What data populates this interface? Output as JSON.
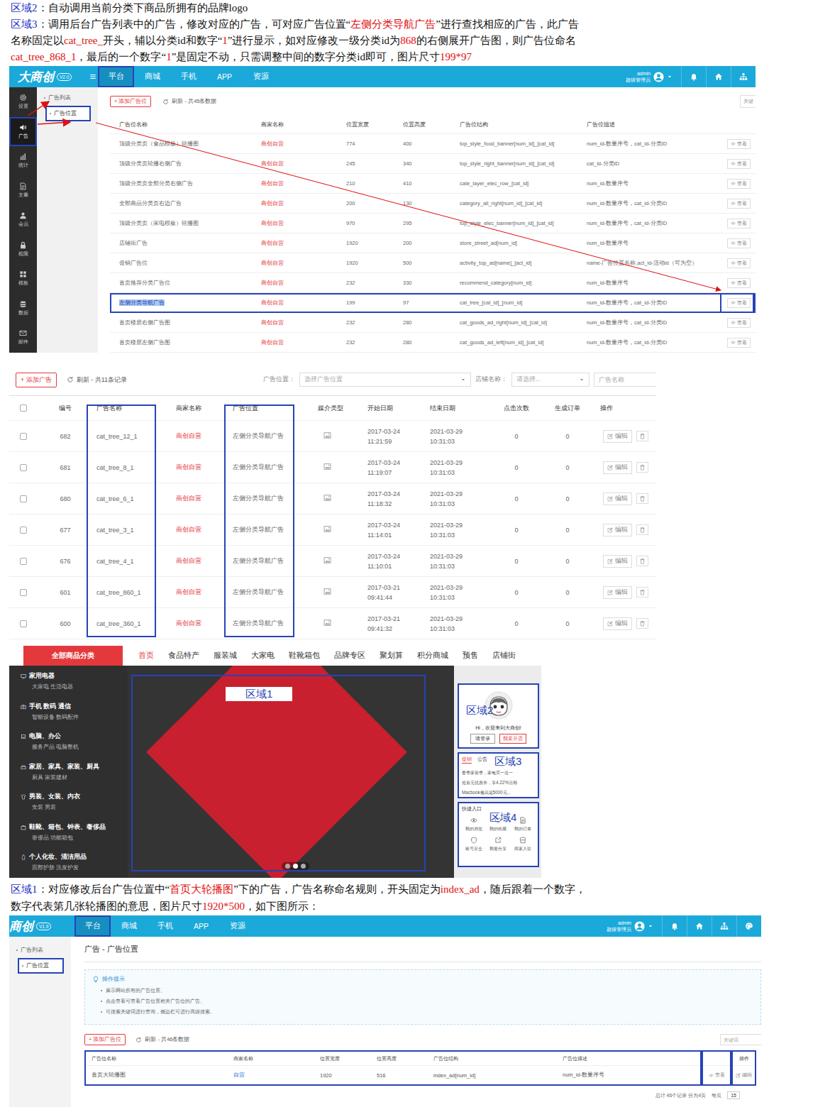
{
  "notes_top": [
    {
      "segments": [
        {
          "text": "区域2",
          "kind": "label"
        },
        {
          "text": "：自动调用当前分类下商品所拥有的品牌logo",
          "kind": "plain"
        }
      ]
    },
    {
      "segments": [
        {
          "text": "区域3",
          "kind": "label"
        },
        {
          "text": "：调用后台广告列表中的广告，修改对应的广告，可对应广告位置“",
          "kind": "plain"
        },
        {
          "text": "左侧分类导航广告",
          "kind": "highlight"
        },
        {
          "text": "”进行查找相应的广告，此广告名称固定以",
          "kind": "plain"
        },
        {
          "text": "cat_tree_",
          "kind": "highlight"
        },
        {
          "text": "开头，辅以分类id和数字“",
          "kind": "plain"
        },
        {
          "text": "1",
          "kind": "highlight"
        },
        {
          "text": "”进行显示，如对应修改一级分类id为",
          "kind": "plain"
        },
        {
          "text": "868",
          "kind": "highlight"
        },
        {
          "text": "的右侧展开广告图，则广告位命名",
          "kind": "plain"
        },
        {
          "text": "cat_tree_868_1",
          "kind": "highlight"
        },
        {
          "text": "，最后的一个数字“",
          "kind": "plain"
        },
        {
          "text": "1",
          "kind": "highlight"
        },
        {
          "text": "”是固定不动，只需调整中间的数字分类id即可，图片尺寸",
          "kind": "plain"
        },
        {
          "text": "199*97",
          "kind": "highlight"
        }
      ]
    }
  ],
  "admin1": {
    "logo": "大商创",
    "version": "V2.0",
    "nav": [
      {
        "label": "平台",
        "selected": true
      },
      {
        "label": "商城",
        "selected": false
      },
      {
        "label": "手机",
        "selected": false
      },
      {
        "label": "APP",
        "selected": false
      },
      {
        "label": "资源",
        "selected": false
      }
    ],
    "user": {
      "name": "admin",
      "role": "超级管理员"
    },
    "sidebar": [
      {
        "label": "设置",
        "selected": false
      },
      {
        "label": "广告",
        "selected": true
      },
      {
        "label": "统计",
        "selected": false
      },
      {
        "label": "文章",
        "selected": false
      },
      {
        "label": "会员",
        "selected": false
      },
      {
        "label": "权限",
        "selected": false
      },
      {
        "label": "模板",
        "selected": false
      },
      {
        "label": "数据",
        "selected": false
      },
      {
        "label": "邮件",
        "selected": false
      }
    ],
    "subnav": [
      {
        "label": "广告列表",
        "selected": false
      },
      {
        "label": "广告位置",
        "selected": true
      }
    ],
    "add_button": "+ 添加广告位",
    "refresh": "刷新 - 共45条数据",
    "keyword": "关键",
    "table": {
      "columns": [
        "广告位名称",
        "商家名称",
        "位置宽度",
        "位置高度",
        "广告位结构",
        "广告位描述"
      ],
      "view": "查看",
      "rows": [
        {
          "cells": [
            "顶级分类页（食品模板）轮播图",
            "商创自营",
            "774",
            "400",
            "top_style_food_banner[num_id]_[cat_id]",
            "num_id-数量序号，cat_id-分类ID"
          ],
          "selected": false
        },
        {
          "cells": [
            "顶级分类页轮播右侧广告",
            "商创自营",
            "245",
            "340",
            "top_style_right_banner[num_id]_[cat_id]",
            "cat_id-分类ID"
          ],
          "selected": false
        },
        {
          "cells": [
            "顶级分类页全部分类右侧广告",
            "商创自营",
            "210",
            "410",
            "cate_layer_elec_row_[cat_id]",
            "num_id-数量序号"
          ],
          "selected": false
        },
        {
          "cells": [
            "全部商品分类页右边广告",
            "商创自营",
            "200",
            "130",
            "category_all_right[num_id]_[cat_id]",
            "num_id-数量序号，cat_id-分类ID"
          ],
          "selected": false
        },
        {
          "cells": [
            "顶级分类页（家电模板）轮播图",
            "商创自营",
            "970",
            "295",
            "top_style_elec_banner[num_id]_[cat_id]",
            "num_id-数量序号，cat_id-分类ID"
          ],
          "selected": false
        },
        {
          "cells": [
            "店铺街广告",
            "商创自营",
            "1920",
            "200",
            "store_street_ad[num_id]",
            "num_id-数量序号"
          ],
          "selected": false
        },
        {
          "cells": [
            "促销广告位",
            "商创自营",
            "1920",
            "500",
            "activity_top_ad[name]_[act_id]",
            "name-广告位置名称,act_id-活动id（可为空）"
          ],
          "selected": false
        },
        {
          "cells": [
            "首页推荐分类广告位",
            "商创自营",
            "232",
            "330",
            "recommend_category[num_id]",
            "num_id-数量序号"
          ],
          "selected": false
        },
        {
          "cells": [
            "左侧分类导航广告",
            "商创自营",
            "199",
            "97",
            "cat_tree_[cat_id]_[num_id]",
            "num_id-数量序号，cat_id-分类ID"
          ],
          "selected": true
        },
        {
          "cells": [
            "首页楼层右侧广告图",
            "商创自营",
            "232",
            "280",
            "cat_goods_ad_right[num_id]_[cat_id]",
            "num_id-数量序号，cat_id-分类ID"
          ],
          "selected": false
        },
        {
          "cells": [
            "首页楼层左侧广告图",
            "商创自营",
            "232",
            "280",
            "cat_goods_ad_left[num_id]_[cat_id]",
            "num_id-数量序号，cat_id-分类ID"
          ],
          "selected": false
        }
      ]
    }
  },
  "adlist": {
    "add_button": "+ 添加广告",
    "refresh": "刷新 - 共11条记录",
    "filters": [
      {
        "label": "广告位置：",
        "placeholder": "选择广告位置"
      },
      {
        "label": "店铺名称：",
        "placeholder": "请选择..."
      }
    ],
    "search_placeholder": "广告名称",
    "header_checked": false,
    "columns": [
      "编号",
      "广告名称",
      "商家名称",
      "广告位置",
      "媒介类型",
      "开始日期",
      "结束日期",
      "点击次数",
      "生成订单",
      "操作"
    ],
    "edit": "编辑",
    "rows": [
      {
        "id": "682",
        "name": "cat_tree_12_1",
        "merchant": "商创自营",
        "position": "左侧分类导航广告",
        "start_date": "2017-03-24",
        "start_time": "11:21:59",
        "end_date": "2021-03-29",
        "end_time": "10:31:03",
        "clicks": "0",
        "orders": "0",
        "checked": false
      },
      {
        "id": "681",
        "name": "cat_tree_8_1",
        "merchant": "商创自营",
        "position": "左侧分类导航广告",
        "start_date": "2017-03-24",
        "start_time": "11:19:07",
        "end_date": "2021-03-29",
        "end_time": "10:31:03",
        "clicks": "0",
        "orders": "0",
        "checked": false
      },
      {
        "id": "680",
        "name": "cat_tree_6_1",
        "merchant": "商创自营",
        "position": "左侧分类导航广告",
        "start_date": "2017-03-24",
        "start_time": "11:18:32",
        "end_date": "2021-03-29",
        "end_time": "10:31:03",
        "clicks": "0",
        "orders": "0",
        "checked": false
      },
      {
        "id": "677",
        "name": "cat_tree_3_1",
        "merchant": "商创自营",
        "position": "左侧分类导航广告",
        "start_date": "2017-03-24",
        "start_time": "11:14:01",
        "end_date": "2021-03-29",
        "end_time": "10:31:03",
        "clicks": "0",
        "orders": "0",
        "checked": false
      },
      {
        "id": "676",
        "name": "cat_tree_4_1",
        "merchant": "商创自营",
        "position": "左侧分类导航广告",
        "start_date": "2017-03-24",
        "start_time": "11:10:01",
        "end_date": "2021-03-29",
        "end_time": "10:31:03",
        "clicks": "0",
        "orders": "0",
        "checked": false
      },
      {
        "id": "601",
        "name": "cat_tree_860_1",
        "merchant": "商创自营",
        "position": "左侧分类导航广告",
        "start_date": "2017-03-21",
        "start_time": "09:41:44",
        "end_date": "2021-03-29",
        "end_time": "10:31:03",
        "clicks": "0",
        "orders": "0",
        "checked": false
      },
      {
        "id": "600",
        "name": "cat_tree_360_1",
        "merchant": "商创自营",
        "position": "左侧分类导航广告",
        "start_date": "2017-03-21",
        "start_time": "09:41:32",
        "end_date": "2021-03-29",
        "end_time": "10:31:03",
        "clicks": "0",
        "orders": "0",
        "checked": false
      }
    ]
  },
  "storefront": {
    "all_categories": "全部商品分类",
    "nav": [
      {
        "label": "首页",
        "selected": true
      },
      {
        "label": "食品特产",
        "selected": false
      },
      {
        "label": "服装城",
        "selected": false
      },
      {
        "label": "大家电",
        "selected": false
      },
      {
        "label": "鞋靴箱包",
        "selected": false
      },
      {
        "label": "品牌专区",
        "selected": false
      },
      {
        "label": "聚划算",
        "selected": false
      },
      {
        "label": "积分商城",
        "selected": false
      },
      {
        "label": "预售",
        "selected": false
      },
      {
        "label": "店铺街",
        "selected": false
      }
    ],
    "categories": [
      {
        "title": "家用电器",
        "sub": "大家电 生活电器"
      },
      {
        "title": "手机 数码 通信",
        "sub": "智能设备 数码配件"
      },
      {
        "title": "电脑、办公",
        "sub": "服务产品 电脑整机"
      },
      {
        "title": "家居、家具、家装、厨具",
        "sub": "厨具 家装建材"
      },
      {
        "title": "男装、女装、内衣",
        "sub": "女装 男装"
      },
      {
        "title": "鞋靴、箱包、钟表、奢侈品",
        "sub": "奢侈品 功能箱包"
      },
      {
        "title": "个人化妆、清洁用品",
        "sub": "面部护肤 洗发护发"
      }
    ],
    "carousel_dots": [
      {
        "selected": false
      },
      {
        "selected": true
      },
      {
        "selected": false
      }
    ],
    "regions": [
      "区域1",
      "区域2",
      "区域3",
      "区域4"
    ],
    "welcome": "Hi，欢迎来到大商创!",
    "login": "请登录",
    "open_shop": "我要开店",
    "news_tabs": [
      {
        "label": "促销",
        "selected": true
      },
      {
        "label": "公告",
        "selected": false
      }
    ],
    "news": [
      "春季家装季，家电买一送一",
      "抢百元优惠券，享4.22%活期",
      "Macbook最高返5000元..."
    ],
    "quick_title": "快捷入口",
    "quick": [
      "我的浏览",
      "我的收藏",
      "我的订单",
      "账号安全",
      "我要分享",
      "商家入驻"
    ]
  },
  "notes_mid": {
    "segments": [
      {
        "text": "区域1",
        "kind": "label"
      },
      {
        "text": "：对应修改后台广告位置中“",
        "kind": "plain"
      },
      {
        "text": "首页大轮播图",
        "kind": "highlight"
      },
      {
        "text": "”下的广告，广告名称命名规则，开头固定为",
        "kind": "plain"
      },
      {
        "text": "index_ad",
        "kind": "highlight"
      },
      {
        "text": "，随后跟着一个数字，数字代表第几张轮播图的意思，图片尺寸",
        "kind": "plain"
      },
      {
        "text": "1920*500",
        "kind": "highlight"
      },
      {
        "text": "，如下图所示：",
        "kind": "plain"
      }
    ]
  },
  "admin2": {
    "logo": "商创",
    "version": "V1.9",
    "nav": [
      {
        "label": "平台",
        "selected": true
      },
      {
        "label": "商城",
        "selected": false
      },
      {
        "label": "手机",
        "selected": false
      },
      {
        "label": "APP",
        "selected": false
      },
      {
        "label": "资源",
        "selected": false
      }
    ],
    "user": {
      "name": "admin",
      "role": "超级管理员"
    },
    "subnav": [
      {
        "label": "广告列表",
        "selected": false
      },
      {
        "label": "广告位置",
        "selected": true
      }
    ],
    "page_title": "广告 - 广告位置",
    "tips_title": "操作提示",
    "tips": [
      "展示网站所有的广告位置。",
      "点击查看可查看广告位置相关广告位的广告。",
      "可搜索关键词进行查询，侧边栏可进行高级搜索。"
    ],
    "add_button": "+ 添加广告位",
    "refresh": "刷新 - 共46条数据",
    "keyword_placeholder": "关键词",
    "table": {
      "columns": [
        "广告位名称",
        "商家名称",
        "位置宽度",
        "位置高度",
        "广告位结构",
        "广告位描述",
        "操作"
      ],
      "rows": [
        {
          "cells": [
            "首页大轮播图",
            "自营",
            "1920",
            "516",
            "index_ad[num_id]",
            "num_id-数量序号"
          ],
          "view": "查看",
          "edit": "编辑"
        }
      ]
    },
    "pagination": {
      "summary": "总计 46个记录 分为4页",
      "per_page_label": "每页",
      "per_page": "15"
    }
  }
}
